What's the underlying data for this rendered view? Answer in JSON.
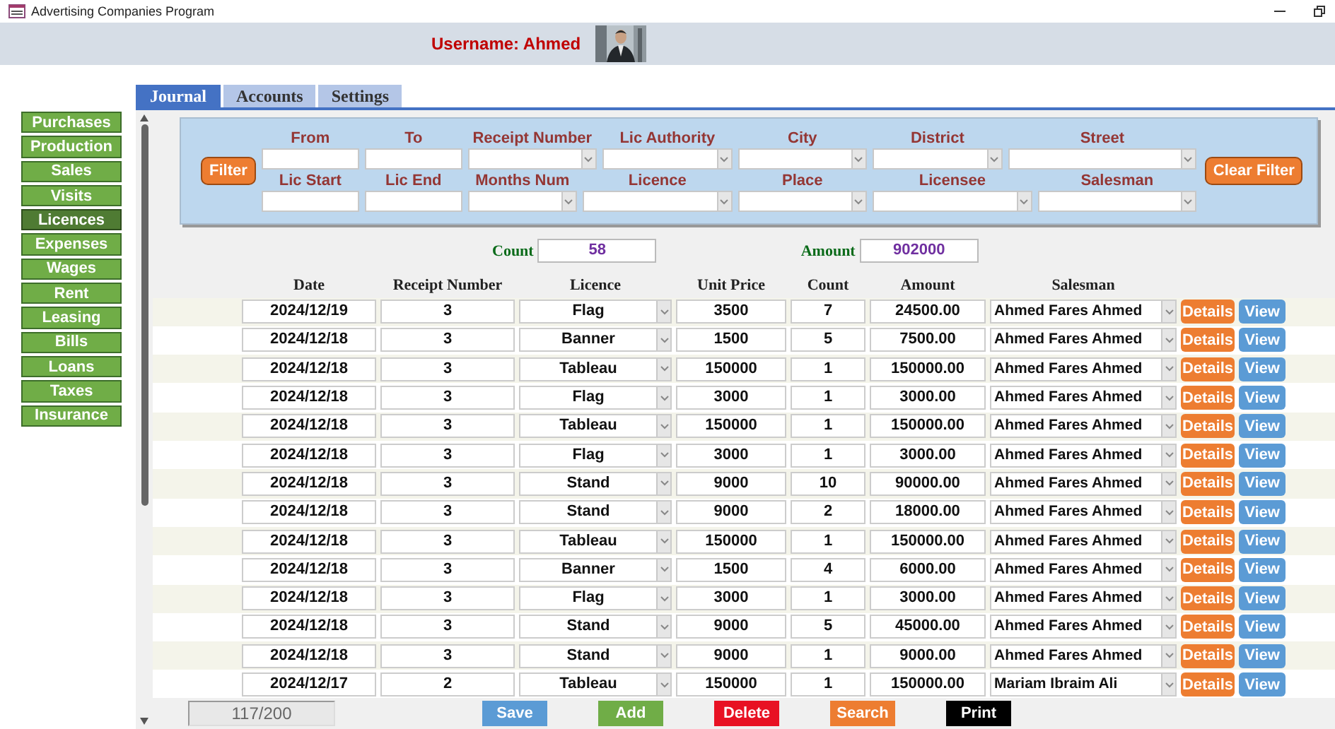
{
  "window": {
    "title": "Advertising Companies Program"
  },
  "header": {
    "username": "Username: Ahmed"
  },
  "sidebar": {
    "items": [
      {
        "label": "Purchases",
        "selected": false
      },
      {
        "label": "Production",
        "selected": false
      },
      {
        "label": "Sales",
        "selected": false
      },
      {
        "label": "Visits",
        "selected": false
      },
      {
        "label": "Licences",
        "selected": true
      },
      {
        "label": "Expenses",
        "selected": false
      },
      {
        "label": "Wages",
        "selected": false
      },
      {
        "label": "Rent",
        "selected": false
      },
      {
        "label": "Leasing",
        "selected": false
      },
      {
        "label": "Bills",
        "selected": false
      },
      {
        "label": "Loans",
        "selected": false
      },
      {
        "label": "Taxes",
        "selected": false
      },
      {
        "label": "Insurance",
        "selected": false
      }
    ]
  },
  "tabs": [
    {
      "label": "Journal",
      "selected": true
    },
    {
      "label": "Accounts",
      "selected": false
    },
    {
      "label": "Settings",
      "selected": false
    }
  ],
  "filter_panel": {
    "filter_button": "Filter",
    "clear_button": "Clear Filter",
    "rows": [
      [
        {
          "label": "From",
          "kind": "text"
        },
        {
          "label": "To",
          "kind": "text"
        },
        {
          "label": "Receipt Number",
          "kind": "combo"
        },
        {
          "label": "Lic Authority",
          "kind": "combo"
        },
        {
          "label": "City",
          "kind": "combo"
        },
        {
          "label": "District",
          "kind": "combo"
        },
        {
          "label": "Street",
          "kind": "combo"
        }
      ],
      [
        {
          "label": "Lic Start",
          "kind": "text"
        },
        {
          "label": "Lic End",
          "kind": "text"
        },
        {
          "label": "Months Num",
          "kind": "combo"
        },
        {
          "label": "Licence",
          "kind": "combo"
        },
        {
          "label": "Place",
          "kind": "combo"
        },
        {
          "label": "Licensee",
          "kind": "combo"
        },
        {
          "label": "Salesman",
          "kind": "combo"
        }
      ]
    ]
  },
  "totals": {
    "count_label": "Count",
    "count": "58",
    "amount_label": "Amount",
    "amount": "902000"
  },
  "table": {
    "columns": [
      "Date",
      "Receipt Number",
      "Licence",
      "Unit Price",
      "Count",
      "Amount",
      "Salesman"
    ],
    "rows": [
      {
        "date": "2024/12/19",
        "receipt": "3",
        "licence": "Flag",
        "unit_price": "3500",
        "count": "7",
        "amount": "24500.00",
        "salesman": "Ahmed Fares Ahmed",
        "details": "Details",
        "view": "View"
      },
      {
        "date": "2024/12/18",
        "receipt": "3",
        "licence": "Banner",
        "unit_price": "1500",
        "count": "5",
        "amount": "7500.00",
        "salesman": "Ahmed Fares Ahmed",
        "details": "Details",
        "view": "View"
      },
      {
        "date": "2024/12/18",
        "receipt": "3",
        "licence": "Tableau",
        "unit_price": "150000",
        "count": "1",
        "amount": "150000.00",
        "salesman": "Ahmed Fares Ahmed",
        "details": "Details",
        "view": "View"
      },
      {
        "date": "2024/12/18",
        "receipt": "3",
        "licence": "Flag",
        "unit_price": "3000",
        "count": "1",
        "amount": "3000.00",
        "salesman": "Ahmed Fares Ahmed",
        "details": "Details",
        "view": "View"
      },
      {
        "date": "2024/12/18",
        "receipt": "3",
        "licence": "Tableau",
        "unit_price": "150000",
        "count": "1",
        "amount": "150000.00",
        "salesman": "Ahmed Fares Ahmed",
        "details": "Details",
        "view": "View"
      },
      {
        "date": "2024/12/18",
        "receipt": "3",
        "licence": "Flag",
        "unit_price": "3000",
        "count": "1",
        "amount": "3000.00",
        "salesman": "Ahmed Fares Ahmed",
        "details": "Details",
        "view": "View"
      },
      {
        "date": "2024/12/18",
        "receipt": "3",
        "licence": "Stand",
        "unit_price": "9000",
        "count": "10",
        "amount": "90000.00",
        "salesman": "Ahmed Fares Ahmed",
        "details": "Details",
        "view": "View"
      },
      {
        "date": "2024/12/18",
        "receipt": "3",
        "licence": "Stand",
        "unit_price": "9000",
        "count": "2",
        "amount": "18000.00",
        "salesman": "Ahmed Fares Ahmed",
        "details": "Details",
        "view": "View"
      },
      {
        "date": "2024/12/18",
        "receipt": "3",
        "licence": "Tableau",
        "unit_price": "150000",
        "count": "1",
        "amount": "150000.00",
        "salesman": "Ahmed Fares Ahmed",
        "details": "Details",
        "view": "View"
      },
      {
        "date": "2024/12/18",
        "receipt": "3",
        "licence": "Banner",
        "unit_price": "1500",
        "count": "4",
        "amount": "6000.00",
        "salesman": "Ahmed Fares Ahmed",
        "details": "Details",
        "view": "View"
      },
      {
        "date": "2024/12/18",
        "receipt": "3",
        "licence": "Flag",
        "unit_price": "3000",
        "count": "1",
        "amount": "3000.00",
        "salesman": "Ahmed Fares Ahmed",
        "details": "Details",
        "view": "View"
      },
      {
        "date": "2024/12/18",
        "receipt": "3",
        "licence": "Stand",
        "unit_price": "9000",
        "count": "5",
        "amount": "45000.00",
        "salesman": "Ahmed Fares Ahmed",
        "details": "Details",
        "view": "View"
      },
      {
        "date": "2024/12/18",
        "receipt": "3",
        "licence": "Stand",
        "unit_price": "9000",
        "count": "1",
        "amount": "9000.00",
        "salesman": "Ahmed Fares Ahmed",
        "details": "Details",
        "view": "View"
      },
      {
        "date": "2024/12/17",
        "receipt": "2",
        "licence": "Tableau",
        "unit_price": "150000",
        "count": "1",
        "amount": "150000.00",
        "salesman": "Mariam Ibraim Ali",
        "details": "Details",
        "view": "View"
      }
    ]
  },
  "record_indicator": "117/200",
  "actions": [
    {
      "label": "Save",
      "color": "#5b9bd5"
    },
    {
      "label": "Add",
      "color": "#70ad47"
    },
    {
      "label": "Delete",
      "color": "#e81123"
    },
    {
      "label": "Search",
      "color": "#ed7d31"
    },
    {
      "label": "Print",
      "color": "#000000"
    }
  ]
}
